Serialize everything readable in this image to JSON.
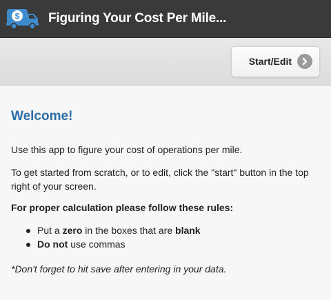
{
  "header": {
    "title": "Figuring Your Cost Per Mile..."
  },
  "toolbar": {
    "start_label": "Start/Edit"
  },
  "content": {
    "welcome": "Welcome!",
    "intro": "Use this app to figure your cost of operations per mile.",
    "instructions": "To get started from scratch, or to edit, click the \"start\" button in the top right of your screen.",
    "rules_title": "For proper calculation please follow these rules:",
    "rules": [
      {
        "pre": "Put a ",
        "bold1": "zero",
        "mid": " in the boxes that are ",
        "bold2": "blank"
      },
      {
        "bold1": "Do not",
        "mid": " use commas"
      }
    ],
    "note": "*Don't forget to hit save after entering in your data."
  },
  "colors": {
    "header_bg": "#3a3a3a",
    "welcome": "#2a6da8",
    "logo_blue": "#3d8bcd"
  },
  "icons": {
    "logo": "money-truck-icon",
    "start": "chevron-right-icon"
  }
}
